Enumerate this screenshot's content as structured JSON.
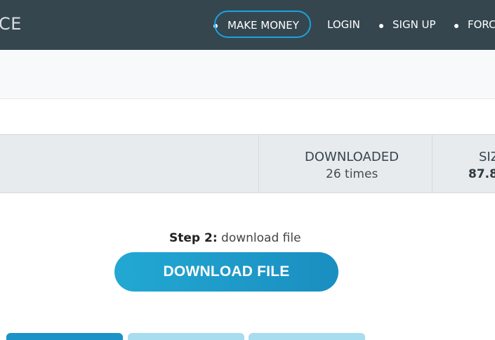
{
  "navbar": {
    "brand_text": "CE",
    "items": [
      {
        "label": "MAKE MONEY"
      },
      {
        "label": "LOGIN"
      },
      {
        "label": "SIGN UP"
      },
      {
        "label": "FORC"
      }
    ]
  },
  "stats": {
    "downloaded_label": "DOWNLOADED",
    "downloaded_value": "26 times",
    "size_label": "SIZ",
    "size_value": "87.8"
  },
  "download": {
    "step_label": "Step 2:",
    "step_text": "download file",
    "button_label": "DOWNLOAD FILE"
  },
  "colors": {
    "navbar_bg": "#35464f",
    "accent": "#1aa3e0",
    "button": "#1e9bcc"
  }
}
